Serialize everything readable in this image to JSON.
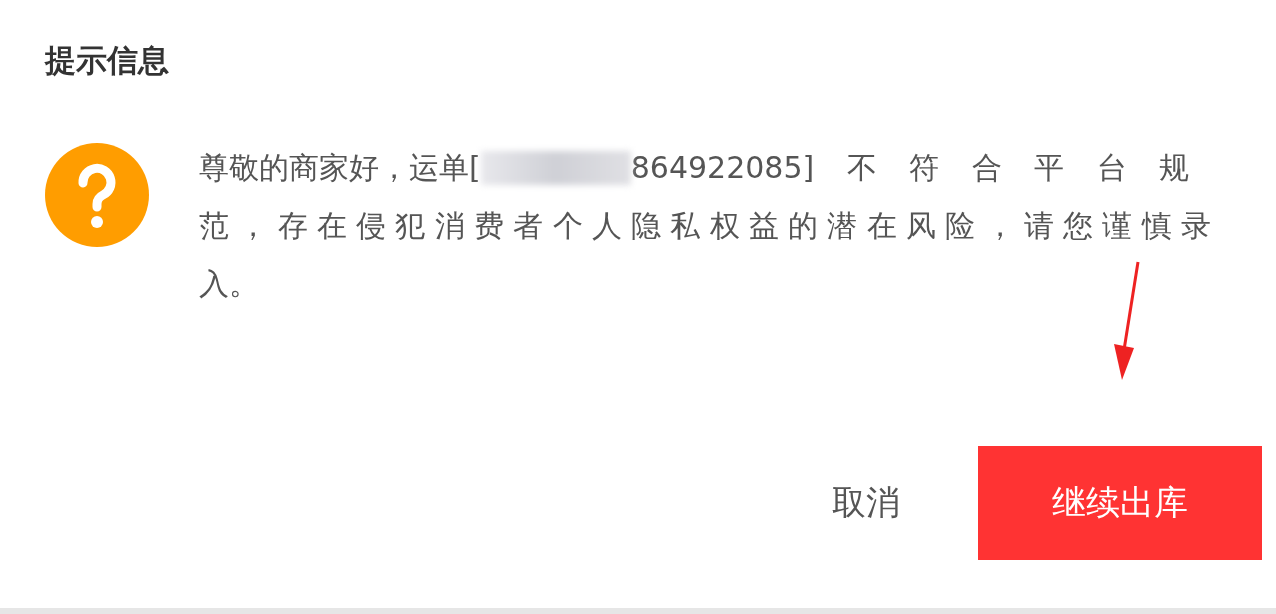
{
  "dialog": {
    "title": "提示信息",
    "icon": {
      "kind": "question"
    },
    "message_lines": [
      {
        "before": "尊敬的商家好，运单[",
        "after": "864922085]不符合平台规"
      },
      {
        "text": "范，存在侵犯消费者个人隐私权益的潜在风险，请您谨慎录"
      },
      {
        "text": "入。"
      }
    ],
    "buttons": [
      {
        "label": "取消",
        "kind": "text"
      },
      {
        "label": "继续出库",
        "kind": "primary"
      }
    ]
  }
}
